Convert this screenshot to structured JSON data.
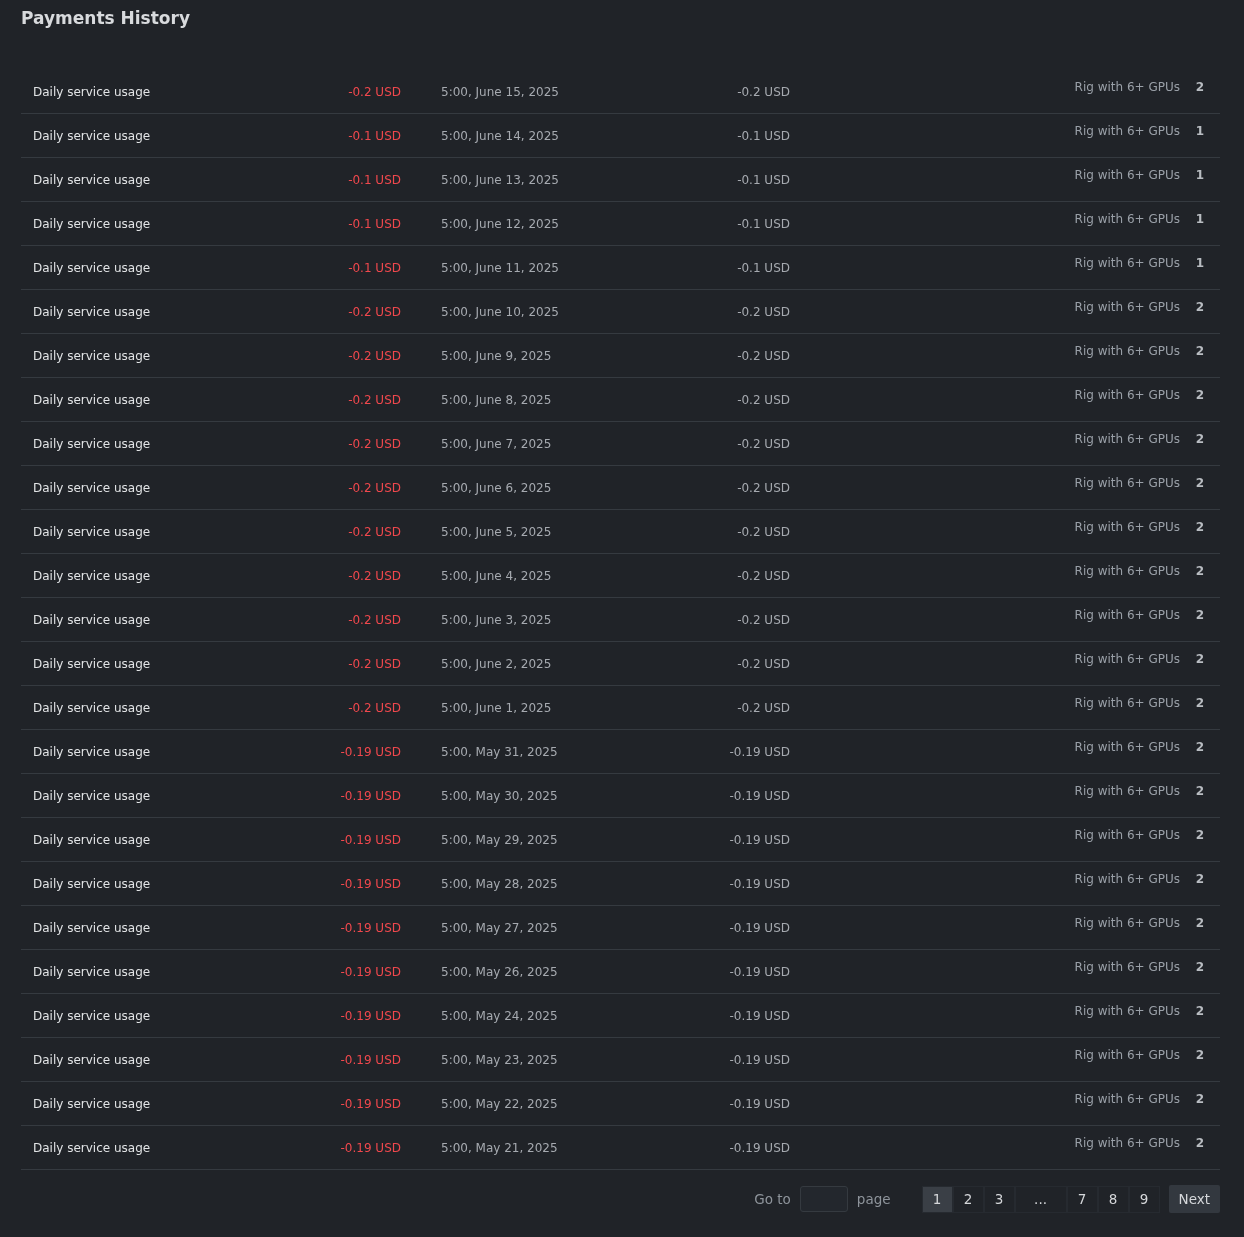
{
  "title": "Payments History",
  "rows": [
    {
      "description": "Daily service usage",
      "amount": "-0.2 USD",
      "date": "5:00, June 15, 2025",
      "balance": "-0.2 USD",
      "rig": "Rig with 6+ GPUs",
      "count": "2"
    },
    {
      "description": "Daily service usage",
      "amount": "-0.1 USD",
      "date": "5:00, June 14, 2025",
      "balance": "-0.1 USD",
      "rig": "Rig with 6+ GPUs",
      "count": "1"
    },
    {
      "description": "Daily service usage",
      "amount": "-0.1 USD",
      "date": "5:00, June 13, 2025",
      "balance": "-0.1 USD",
      "rig": "Rig with 6+ GPUs",
      "count": "1"
    },
    {
      "description": "Daily service usage",
      "amount": "-0.1 USD",
      "date": "5:00, June 12, 2025",
      "balance": "-0.1 USD",
      "rig": "Rig with 6+ GPUs",
      "count": "1"
    },
    {
      "description": "Daily service usage",
      "amount": "-0.1 USD",
      "date": "5:00, June 11, 2025",
      "balance": "-0.1 USD",
      "rig": "Rig with 6+ GPUs",
      "count": "1"
    },
    {
      "description": "Daily service usage",
      "amount": "-0.2 USD",
      "date": "5:00, June 10, 2025",
      "balance": "-0.2 USD",
      "rig": "Rig with 6+ GPUs",
      "count": "2"
    },
    {
      "description": "Daily service usage",
      "amount": "-0.2 USD",
      "date": "5:00, June 9, 2025",
      "balance": "-0.2 USD",
      "rig": "Rig with 6+ GPUs",
      "count": "2"
    },
    {
      "description": "Daily service usage",
      "amount": "-0.2 USD",
      "date": "5:00, June 8, 2025",
      "balance": "-0.2 USD",
      "rig": "Rig with 6+ GPUs",
      "count": "2"
    },
    {
      "description": "Daily service usage",
      "amount": "-0.2 USD",
      "date": "5:00, June 7, 2025",
      "balance": "-0.2 USD",
      "rig": "Rig with 6+ GPUs",
      "count": "2"
    },
    {
      "description": "Daily service usage",
      "amount": "-0.2 USD",
      "date": "5:00, June 6, 2025",
      "balance": "-0.2 USD",
      "rig": "Rig with 6+ GPUs",
      "count": "2"
    },
    {
      "description": "Daily service usage",
      "amount": "-0.2 USD",
      "date": "5:00, June 5, 2025",
      "balance": "-0.2 USD",
      "rig": "Rig with 6+ GPUs",
      "count": "2"
    },
    {
      "description": "Daily service usage",
      "amount": "-0.2 USD",
      "date": "5:00, June 4, 2025",
      "balance": "-0.2 USD",
      "rig": "Rig with 6+ GPUs",
      "count": "2"
    },
    {
      "description": "Daily service usage",
      "amount": "-0.2 USD",
      "date": "5:00, June 3, 2025",
      "balance": "-0.2 USD",
      "rig": "Rig with 6+ GPUs",
      "count": "2"
    },
    {
      "description": "Daily service usage",
      "amount": "-0.2 USD",
      "date": "5:00, June 2, 2025",
      "balance": "-0.2 USD",
      "rig": "Rig with 6+ GPUs",
      "count": "2"
    },
    {
      "description": "Daily service usage",
      "amount": "-0.2 USD",
      "date": "5:00, June 1, 2025",
      "balance": "-0.2 USD",
      "rig": "Rig with 6+ GPUs",
      "count": "2"
    },
    {
      "description": "Daily service usage",
      "amount": "-0.19 USD",
      "date": "5:00, May 31, 2025",
      "balance": "-0.19 USD",
      "rig": "Rig with 6+ GPUs",
      "count": "2"
    },
    {
      "description": "Daily service usage",
      "amount": "-0.19 USD",
      "date": "5:00, May 30, 2025",
      "balance": "-0.19 USD",
      "rig": "Rig with 6+ GPUs",
      "count": "2"
    },
    {
      "description": "Daily service usage",
      "amount": "-0.19 USD",
      "date": "5:00, May 29, 2025",
      "balance": "-0.19 USD",
      "rig": "Rig with 6+ GPUs",
      "count": "2"
    },
    {
      "description": "Daily service usage",
      "amount": "-0.19 USD",
      "date": "5:00, May 28, 2025",
      "balance": "-0.19 USD",
      "rig": "Rig with 6+ GPUs",
      "count": "2"
    },
    {
      "description": "Daily service usage",
      "amount": "-0.19 USD",
      "date": "5:00, May 27, 2025",
      "balance": "-0.19 USD",
      "rig": "Rig with 6+ GPUs",
      "count": "2"
    },
    {
      "description": "Daily service usage",
      "amount": "-0.19 USD",
      "date": "5:00, May 26, 2025",
      "balance": "-0.19 USD",
      "rig": "Rig with 6+ GPUs",
      "count": "2"
    },
    {
      "description": "Daily service usage",
      "amount": "-0.19 USD",
      "date": "5:00, May 24, 2025",
      "balance": "-0.19 USD",
      "rig": "Rig with 6+ GPUs",
      "count": "2"
    },
    {
      "description": "Daily service usage",
      "amount": "-0.19 USD",
      "date": "5:00, May 23, 2025",
      "balance": "-0.19 USD",
      "rig": "Rig with 6+ GPUs",
      "count": "2"
    },
    {
      "description": "Daily service usage",
      "amount": "-0.19 USD",
      "date": "5:00, May 22, 2025",
      "balance": "-0.19 USD",
      "rig": "Rig with 6+ GPUs",
      "count": "2"
    },
    {
      "description": "Daily service usage",
      "amount": "-0.19 USD",
      "date": "5:00, May 21, 2025",
      "balance": "-0.19 USD",
      "rig": "Rig with 6+ GPUs",
      "count": "2"
    }
  ],
  "pagination": {
    "goto_label": "Go to",
    "goto_suffix": "page",
    "pages": [
      {
        "label": "1",
        "selected": true
      },
      {
        "label": "2",
        "selected": false
      },
      {
        "label": "3",
        "selected": false
      },
      {
        "label": "...",
        "selected": false
      },
      {
        "label": "7",
        "selected": false
      },
      {
        "label": "8",
        "selected": false
      },
      {
        "label": "9",
        "selected": false
      }
    ],
    "next": "Next"
  }
}
